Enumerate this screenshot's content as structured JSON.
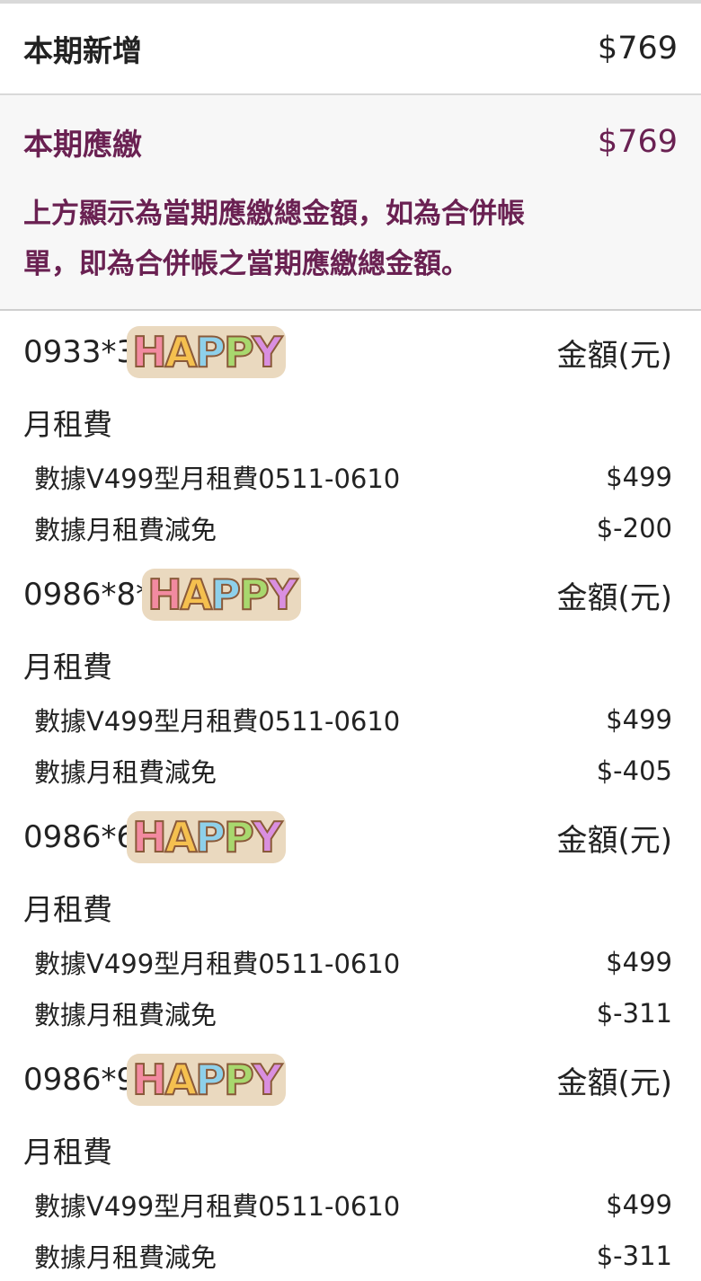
{
  "summary": {
    "new_label": "本期新增",
    "new_value": "$769"
  },
  "due": {
    "label": "本期應繳",
    "value": "$769",
    "notice_line1": "上方顯示為當期應繳總金額，如為合併帳",
    "notice_line2": "單，即為合併帳之當期應繳總金額。"
  },
  "sticker_text": "HAPPY",
  "sticker_colors": [
    "#f28aa0",
    "#f5c04f",
    "#8ed0ea",
    "#a8d86e",
    "#d98fe0"
  ],
  "accounts": [
    {
      "id": "0933*3",
      "header": "金額(元)",
      "category": "月租費",
      "items": [
        {
          "label": "數據V499型月租費0511-0610",
          "amount": "$499"
        },
        {
          "label": "數據月租費減免",
          "amount": "$-200"
        }
      ]
    },
    {
      "id": "0986*8*",
      "header": "金額(元)",
      "category": "月租費",
      "items": [
        {
          "label": "數據V499型月租費0511-0610",
          "amount": "$499"
        },
        {
          "label": "數據月租費減免",
          "amount": "$-405"
        }
      ]
    },
    {
      "id": "0986*6",
      "header": "金額(元)",
      "category": "月租費",
      "items": [
        {
          "label": "數據V499型月租費0511-0610",
          "amount": "$499"
        },
        {
          "label": "數據月租費減免",
          "amount": "$-311"
        }
      ]
    },
    {
      "id": "0986*9",
      "header": "金額(元)",
      "category": "月租費",
      "items": [
        {
          "label": "數據V499型月租費0511-0610",
          "amount": "$499"
        },
        {
          "label": "數據月租費減免",
          "amount": "$-311"
        }
      ]
    }
  ]
}
